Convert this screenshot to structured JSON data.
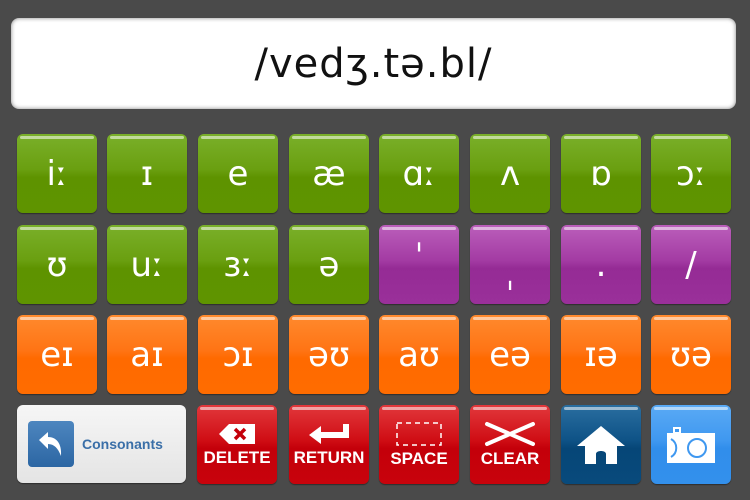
{
  "display": {
    "text": "/vedʒ.tə.bl/"
  },
  "rows": [
    {
      "color": "green",
      "keys": [
        "iː",
        "ɪ",
        "e",
        "æ",
        "ɑː",
        "ʌ",
        "ɒ",
        "ɔː"
      ]
    },
    {
      "color": "mixed",
      "keys": [
        "ʊ",
        "uː",
        "ɜː",
        "ə",
        "ˈ",
        "ˌ",
        ".",
        "/"
      ]
    },
    {
      "color": "orange",
      "keys": [
        "eɪ",
        "aɪ",
        "ɔɪ",
        "əʊ",
        "aʊ",
        "eə",
        "ɪə",
        "ʊə"
      ]
    }
  ],
  "controls": {
    "consonants_label": "Consonants",
    "delete_label": "DELETE",
    "return_label": "RETURN",
    "space_label": "SPACE",
    "clear_label": "CLEAR"
  },
  "icons": {
    "consonants": "back-arrow-icon",
    "delete": "backspace-icon",
    "return": "return-icon",
    "space": "space-icon",
    "clear": "clear-icon",
    "home": "home-icon",
    "camera": "camera-icon"
  },
  "colors": {
    "green": "#6a9f10",
    "purple": "#a33ba3",
    "orange": "#ff7414",
    "red": "#cf0d14",
    "navy": "#0e5286",
    "sky": "#3f98f0",
    "background": "#4a4a4a"
  }
}
